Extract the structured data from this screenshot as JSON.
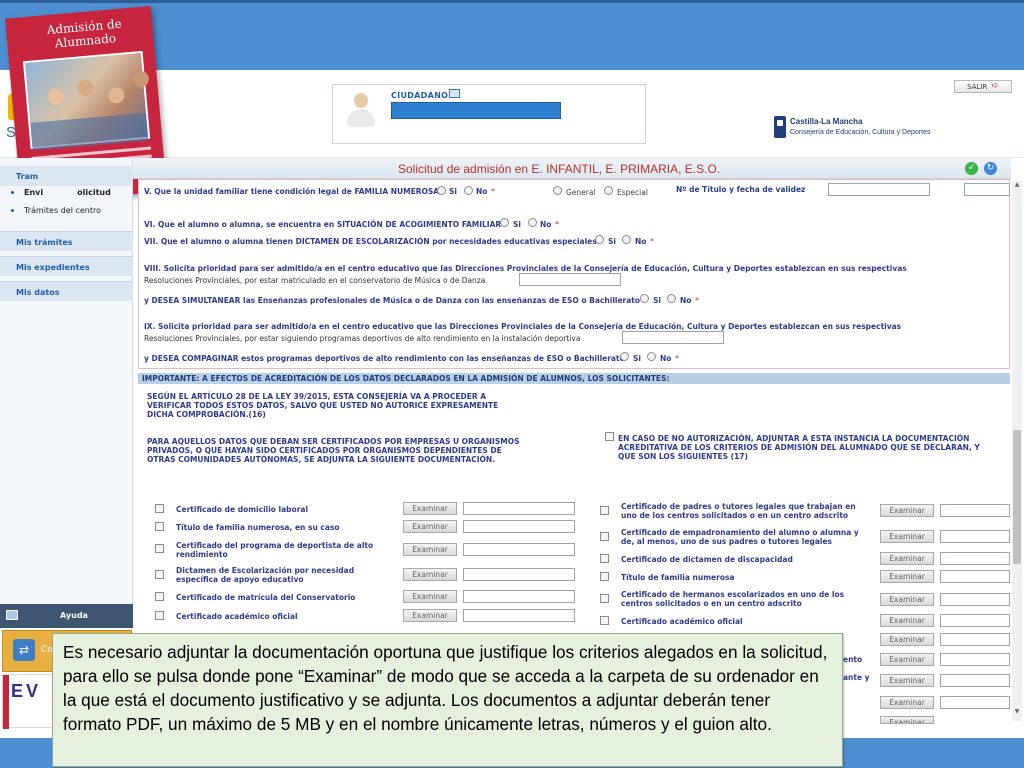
{
  "header": {
    "citizen_label": "CIUDADANO",
    "exit_label": "SALIR",
    "org_name": "Castilla-La Mancha",
    "org_dept": "Consejería de Educación, Cultura y Deportes",
    "sec_text": "Sec"
  },
  "brochure": {
    "title": "Admisión de Alumnado"
  },
  "sidebar": {
    "head": "Tram",
    "sub_items": [
      {
        "prefix": "Envi",
        "bold": "olicitud"
      },
      {
        "label": "Trámites del centro"
      }
    ],
    "items": [
      {
        "label": "Mis trámites"
      },
      {
        "label": "Mis expedientes"
      },
      {
        "label": "Mis datos"
      }
    ],
    "help": "Ayuda",
    "tile1": "Co",
    "tile2": "EV"
  },
  "form": {
    "title": "Solicitud de admisión en E. INFANTIL, E. PRIMARIA, E.S.O.",
    "yes": "Si",
    "no": "No",
    "q5": "V. Que la unidad familiar tiene condición legal de FAMILIA NUMEROSA",
    "general": "General",
    "especial": "Especial",
    "titulo_label": "Nº de Título y fecha de validez",
    "q6": "VI. Que el alumno o alumna, se encuentra en SITUACIÓN DE ACOGIMIENTO FAMILIAR",
    "q7": "VII. Que el alumno o alumna tienen DICTAMEN DE ESCOLARIZACIÓN por necesidades educativas especiales",
    "q8_line1": "VIII. Solicita prioridad para ser admitido/a en el centro educativo que las Direcciones Provinciales de la Consejería de Educación, Cultura y Deportes establezcan en sus respectivas",
    "q8_line2": "Resoluciones Provinciales, por estar matriculado en el conservatorio de Música o de Danza",
    "q8_b": "y DESEA SIMULTANEAR las Enseñanzas profesionales de Música o de Danza con las enseñanzas de ESO o Bachillerato",
    "q9_line1": "IX. Solicita prioridad para ser admitido/a en el centro educativo que las Direcciones Provinciales de la Consejería de Educación, Cultura y Deportes establezcan en sus respectivas",
    "q9_line2": "Resoluciones Provinciales, por estar siguiendo programas deportivos de alto rendimiento en la instalación deportiva",
    "q9_b": "y DESEA COMPAGINAR estos programas deportivos de alto rendimiento con las enseñanzas de ESO o Bachillerato",
    "important": "IMPORTANTE: A EFECTOS DE ACREDITACIÓN DE LOS DATOS DECLARADOS EN LA ADMISIÓN DE ALUMNOS, LOS SOLICITANTES:",
    "para1": "SEGÚN EL ARTÍCULO 28 DE LA LEY 39/2015, ESTA CONSEJERÍA VA A PROCEDER A VERIFICAR TODOS ESTOS DATOS, SALVO QUE USTED NO AUTORICE EXPRESAMENTE DICHA COMPROBACIÓN.(16)",
    "para2": "PARA AQUELLOS DATOS QUE DEBAN SER CERTIFICADOS POR EMPRESAS U ORGANISMOS PRIVADOS, O QUE HAYAN SIDO CERTIFICADOS POR ORGANISMOS DEPENDIENTES DE OTRAS COMUNIDADES AUTÓNOMAS, SE ADJUNTA LA SIGUIENTE DOCUMENTACIÓN.",
    "para3": "EN CASO DE NO AUTORIZACIÓN, ADJUNTAR A ESTA INSTANCIA LA DOCUMENTACIÓN ACREDITATIVA DE LOS CRITERIOS DE ADMISIÓN DEL ALUMNADO QUE SE DECLARAN, Y QUE SON LOS SIGUIENTES (17)",
    "examine": "Examinar",
    "left_certs": [
      "Certificado de domicilio laboral",
      "Título de familia numerosa, en su caso",
      "Certificado del programa de deportista de alto rendimiento",
      "Dictamen de Escolarización por necesidad específica de apoyo educativo",
      "Certificado de matrícula del Conservatorio",
      "Certificado académico oficial"
    ],
    "right_certs": [
      "Certificado de padres o tutores legales que trabajan en uno de los centros solicitados o en un centro adscrito",
      "Certificado de empadronamiento del alumno o alumna y de, al menos, uno de sus padres o tutores legales",
      "Certificado de dictamen de discapacidad",
      "Título de familia numerosa",
      "Certificado de hermanos escolarizados en uno de los centros solicitados o en un centro adscrito",
      "Certificado académico oficial"
    ],
    "partial_right_1": "ento",
    "partial_right_2": "ante y"
  },
  "callout": {
    "text": "Es necesario adjuntar la documentación oportuna que justifique los criterios alegados en la solicitud, para ello se pulsa donde pone “Examinar” de modo que se acceda a la carpeta de su ordenador en la que está el documento justificativo y se adjunta. Los documentos a adjuntar deberán tener formato PDF, un máximo de 5 MB y en el nombre únicamente letras, números y el guion alto."
  },
  "colors": {
    "top_bar": "#4d8fd0",
    "title_red": "#b5322b",
    "label_blue": "#2d3c8e",
    "callout_bg": "#e6f1dd"
  }
}
